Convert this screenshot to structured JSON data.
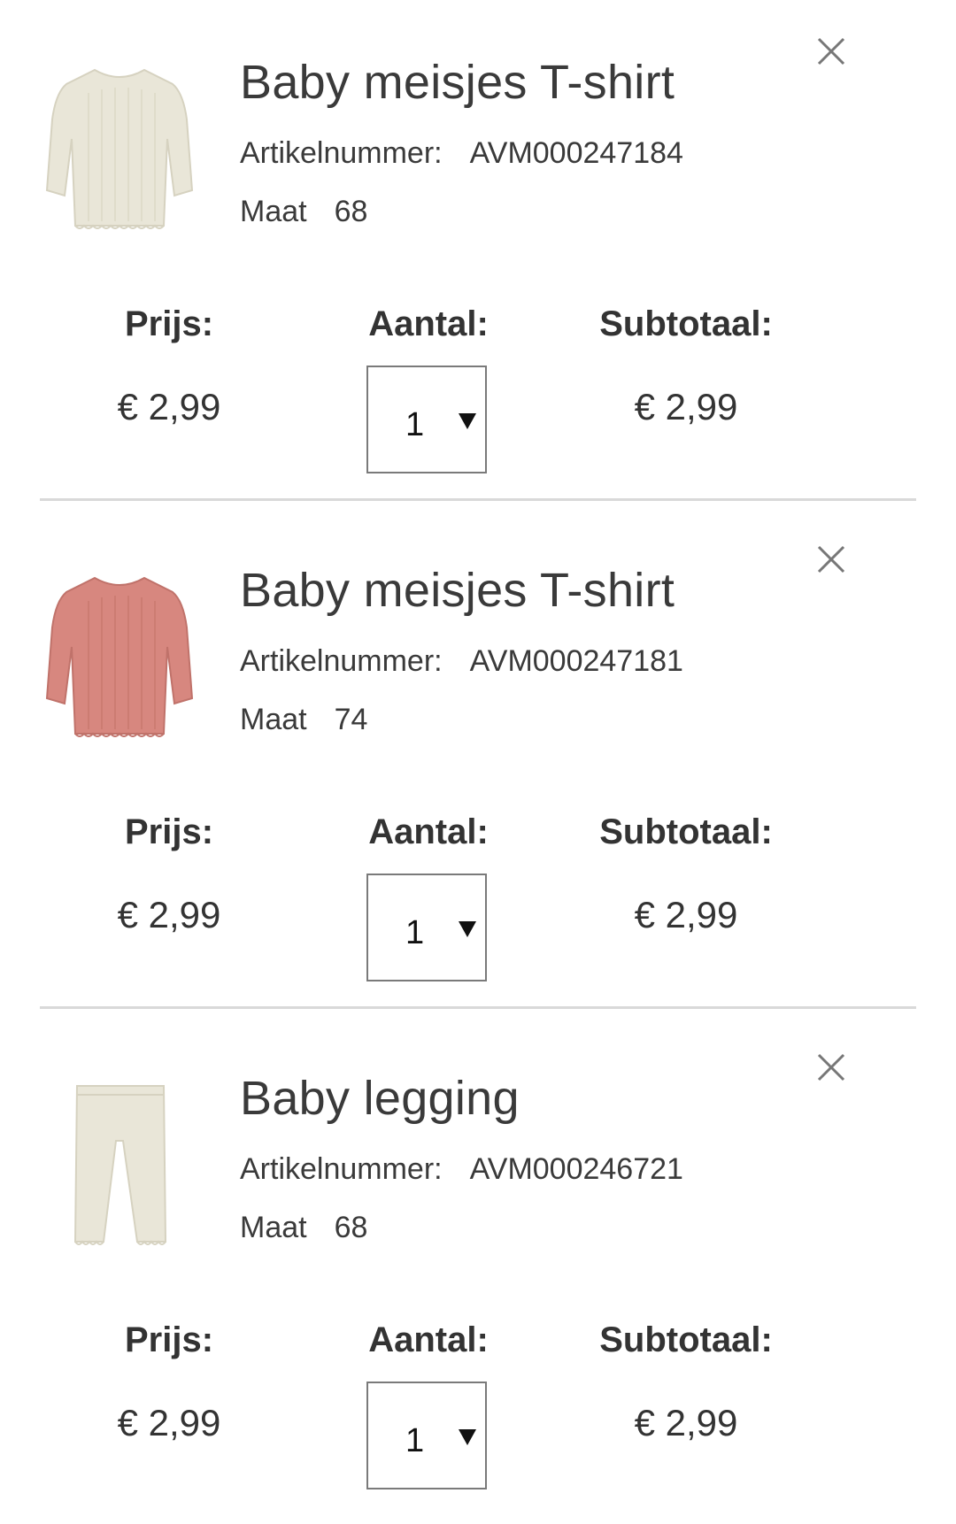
{
  "cart": {
    "price_label": "Prijs:",
    "quantity_label": "Aantal:",
    "subtotal_label": "Subtotaal:",
    "sku_label": "Artikelnummer:",
    "size_label": "Maat",
    "items": [
      {
        "title": "Baby meisjes T-shirt",
        "sku": "AVM000247184",
        "size": "68",
        "price": "€ 2,99",
        "quantity": "1",
        "subtotal": "€ 2,99",
        "image_icon": "cream-longsleeve-shirt-icon",
        "image_color": "#e9e6d8"
      },
      {
        "title": "Baby meisjes T-shirt",
        "sku": "AVM000247181",
        "size": "74",
        "price": "€ 2,99",
        "quantity": "1",
        "subtotal": "€ 2,99",
        "image_icon": "pink-longsleeve-shirt-icon",
        "image_color": "#d7877f"
      },
      {
        "title": "Baby legging",
        "sku": "AVM000246721",
        "size": "68",
        "price": "€ 2,99",
        "quantity": "1",
        "subtotal": "€ 2,99",
        "image_icon": "cream-legging-icon",
        "image_color": "#e9e6d8"
      }
    ]
  }
}
